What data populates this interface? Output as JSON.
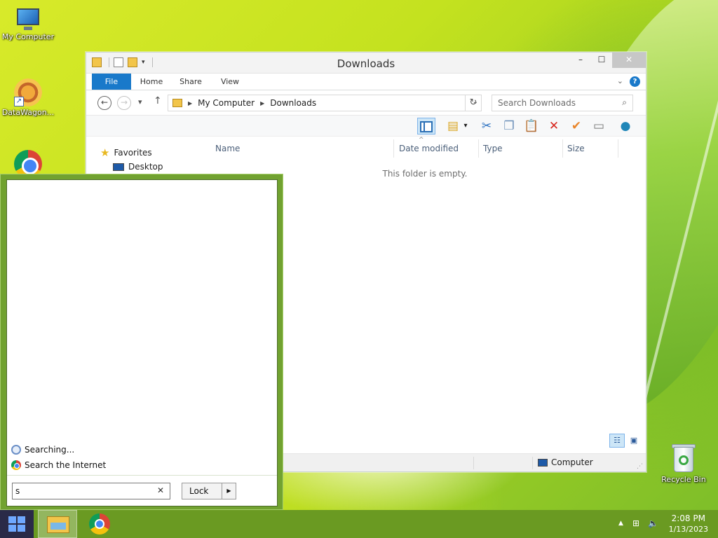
{
  "desktop": {
    "icons": [
      {
        "label": "My Computer"
      },
      {
        "label": "DataWagon..."
      },
      {
        "label": "Recycle Bin"
      }
    ]
  },
  "explorer": {
    "title": "Downloads",
    "tabs": {
      "file": "File",
      "home": "Home",
      "share": "Share",
      "view": "View"
    },
    "help": "?",
    "address": {
      "root": "My Computer",
      "current": "Downloads"
    },
    "search_placeholder": "Search Downloads",
    "navpane": {
      "favorites": "Favorites",
      "desktop": "Desktop"
    },
    "columns": {
      "name": "Name",
      "date_modified": "Date modified",
      "type": "Type",
      "size": "Size"
    },
    "empty_message": "This folder is empty.",
    "status": {
      "location": "Computer"
    }
  },
  "start_menu": {
    "results": {
      "searching": "Searching...",
      "search_internet": "Search the Internet"
    },
    "search_value": "s",
    "lock_label": "Lock"
  },
  "taskbar": {
    "time": "2:08 PM",
    "date": "1/13/2023"
  }
}
